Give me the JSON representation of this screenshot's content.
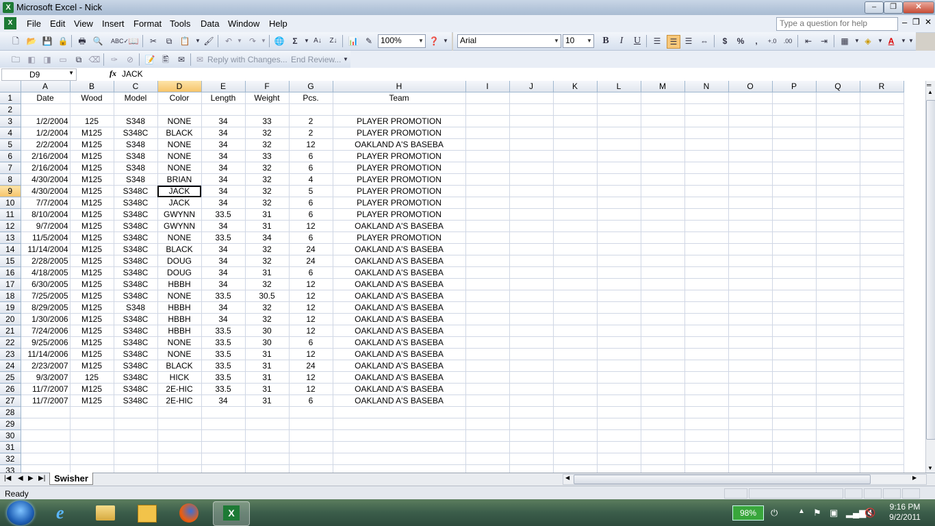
{
  "window": {
    "title": "Microsoft Excel - Nick"
  },
  "menu": [
    "File",
    "Edit",
    "View",
    "Insert",
    "Format",
    "Tools",
    "Data",
    "Window",
    "Help"
  ],
  "help_box": {
    "placeholder": "Type a question for help"
  },
  "toolbar": {
    "zoom": "100%",
    "font": "Arial",
    "font_size": "10",
    "bold": "B",
    "italic": "I",
    "underline": "U",
    "currency": "$",
    "percent": "%",
    "comma": ",",
    "reply_with_changes": "Reply with Changes...",
    "end_review": "End Review..."
  },
  "formula_bar": {
    "cell_ref": "D9",
    "fx": "fx",
    "value": "JACK"
  },
  "sheet": {
    "columns": [
      "A",
      "B",
      "C",
      "D",
      "E",
      "F",
      "G",
      "H",
      "I",
      "J",
      "K",
      "L",
      "M",
      "N",
      "O",
      "P",
      "Q",
      "R"
    ],
    "active_col": "D",
    "active_row": 9,
    "row_numbers": [
      1,
      2,
      3,
      4,
      5,
      6,
      7,
      8,
      9,
      10,
      11,
      12,
      13,
      14,
      15,
      16,
      17,
      18,
      19,
      20,
      21,
      22,
      23,
      24,
      25,
      26,
      27,
      28,
      29,
      30,
      31,
      32,
      33
    ],
    "headers": [
      "Date",
      "Wood",
      "Model",
      "Color",
      "Length",
      "Weight",
      "Pcs.",
      "Team"
    ],
    "rows": [
      [
        "1/2/2004",
        "125",
        "S348",
        "NONE",
        "34",
        "33",
        "2",
        "PLAYER PROMOTION"
      ],
      [
        "1/2/2004",
        "M125",
        "S348C",
        "BLACK",
        "34",
        "32",
        "2",
        "PLAYER PROMOTION"
      ],
      [
        "2/2/2004",
        "M125",
        "S348",
        "NONE",
        "34",
        "32",
        "12",
        "OAKLAND A'S BASEBA"
      ],
      [
        "2/16/2004",
        "M125",
        "S348",
        "NONE",
        "34",
        "33",
        "6",
        "PLAYER PROMOTION"
      ],
      [
        "2/16/2004",
        "M125",
        "S348",
        "NONE",
        "34",
        "32",
        "6",
        "PLAYER PROMOTION"
      ],
      [
        "4/30/2004",
        "M125",
        "S348",
        "BRIAN",
        "34",
        "32",
        "4",
        "PLAYER PROMOTION"
      ],
      [
        "4/30/2004",
        "M125",
        "S348C",
        "JACK",
        "34",
        "32",
        "5",
        "PLAYER PROMOTION"
      ],
      [
        "7/7/2004",
        "M125",
        "S348C",
        "JACK",
        "34",
        "32",
        "6",
        "PLAYER PROMOTION"
      ],
      [
        "8/10/2004",
        "M125",
        "S348C",
        "GWYNN",
        "33.5",
        "31",
        "6",
        "PLAYER PROMOTION"
      ],
      [
        "9/7/2004",
        "M125",
        "S348C",
        "GWYNN",
        "34",
        "31",
        "12",
        "OAKLAND A'S BASEBA"
      ],
      [
        "11/5/2004",
        "M125",
        "S348C",
        "NONE",
        "33.5",
        "34",
        "6",
        "PLAYER PROMOTION"
      ],
      [
        "11/14/2004",
        "M125",
        "S348C",
        "BLACK",
        "34",
        "32",
        "24",
        "OAKLAND A'S BASEBA"
      ],
      [
        "2/28/2005",
        "M125",
        "S348C",
        "DOUG",
        "34",
        "32",
        "24",
        "OAKLAND A'S BASEBA"
      ],
      [
        "4/18/2005",
        "M125",
        "S348C",
        "DOUG",
        "34",
        "31",
        "6",
        "OAKLAND A'S BASEBA"
      ],
      [
        "6/30/2005",
        "M125",
        "S348C",
        "HBBH",
        "34",
        "32",
        "12",
        "OAKLAND A'S BASEBA"
      ],
      [
        "7/25/2005",
        "M125",
        "S348C",
        "NONE",
        "33.5",
        "30.5",
        "12",
        "OAKLAND A'S BASEBA"
      ],
      [
        "8/29/2005",
        "M125",
        "S348",
        "HBBH",
        "34",
        "32",
        "12",
        "OAKLAND A'S BASEBA"
      ],
      [
        "1/30/2006",
        "M125",
        "S348C",
        "HBBH",
        "34",
        "32",
        "12",
        "OAKLAND A'S BASEBA"
      ],
      [
        "7/24/2006",
        "M125",
        "S348C",
        "HBBH",
        "33.5",
        "30",
        "12",
        "OAKLAND A'S BASEBA"
      ],
      [
        "9/25/2006",
        "M125",
        "S348C",
        "NONE",
        "33.5",
        "30",
        "6",
        "OAKLAND A'S BASEBA"
      ],
      [
        "11/14/2006",
        "M125",
        "S348C",
        "NONE",
        "33.5",
        "31",
        "12",
        "OAKLAND A'S BASEBA"
      ],
      [
        "2/23/2007",
        "M125",
        "S348C",
        "BLACK",
        "33.5",
        "31",
        "24",
        "OAKLAND A'S BASEBA"
      ],
      [
        "9/3/2007",
        "125",
        "S348C",
        "HICK",
        "33.5",
        "31",
        "12",
        "OAKLAND A'S BASEBA"
      ],
      [
        "11/7/2007",
        "M125",
        "S348C",
        "2E-HIC",
        "33.5",
        "31",
        "12",
        "OAKLAND A'S BASEBA"
      ],
      [
        "11/7/2007",
        "M125",
        "S348C",
        "2E-HIC",
        "34",
        "31",
        "6",
        "OAKLAND A'S BASEBA"
      ]
    ]
  },
  "sheet_tab": "Swisher",
  "status": "Ready",
  "taskbar": {
    "battery": "98%",
    "time": "9:16 PM",
    "date": "9/2/2011"
  },
  "colors": {
    "active_header": "#f6c46a",
    "grid_line": "#d0d7e5",
    "selection": "#000000"
  }
}
